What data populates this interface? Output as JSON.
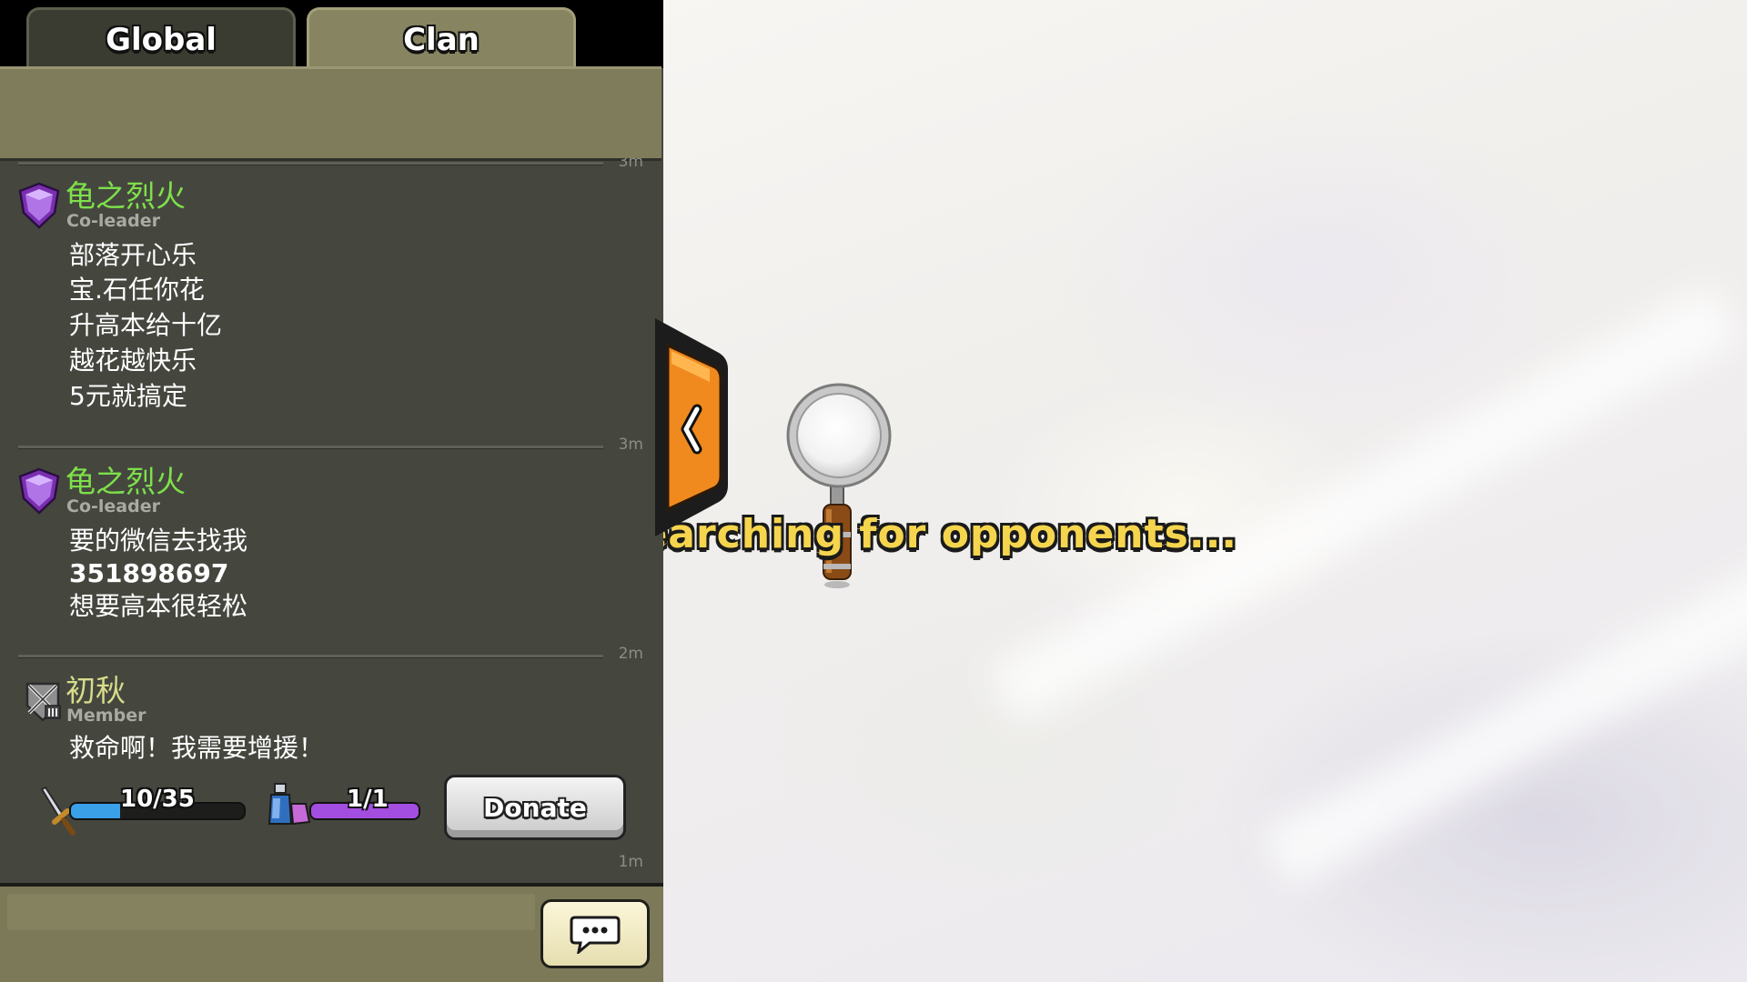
{
  "tabs": [
    {
      "label": "Global",
      "active": false
    },
    {
      "label": "Clan",
      "active": true
    }
  ],
  "messages": [
    {
      "timestamp_above": "3m",
      "badge": "purple-league-shield",
      "name": "龟之烈火",
      "name_color": "#7ee04a",
      "role": "Co-leader",
      "lines": [
        "部落开心乐",
        "宝.石任你花",
        "升高本给十亿",
        "越花越快乐",
        "5元就搞定"
      ]
    },
    {
      "timestamp_above": "3m",
      "badge": "purple-league-shield",
      "name": "龟之烈火",
      "name_color": "#7ee04a",
      "role": "Co-leader",
      "lines": [
        "要的微信去找我",
        "351898697",
        "想要高本很轻松"
      ]
    },
    {
      "timestamp_above": "2m",
      "badge": "silver-league-shield",
      "name": "初秋",
      "name_color": "#d8dc8a",
      "role": "Member",
      "lines": [
        "救命啊！我需要增援！"
      ],
      "request": {
        "troops": {
          "label": "10/35",
          "fraction": 0.2857
        },
        "spells": {
          "label": "1/1",
          "fraction": 1.0
        },
        "donate_label": "Donate"
      },
      "timestamp": "1m"
    }
  ],
  "searching_text": "Searching for opponents...",
  "colors": {
    "panel": "#45473f",
    "tab_active": "#878462",
    "troop_bar": "#3aa0e8",
    "spell_bar": "#a34ee0",
    "search_text": "#f6d54e",
    "collapse_button": "#f08a1e"
  },
  "icons": {
    "collapse": "chevron-left-icon",
    "chat": "speech-bubble-icon",
    "troops": "sword-icon",
    "spells": "potion-icon",
    "search": "magnifier-icon"
  }
}
